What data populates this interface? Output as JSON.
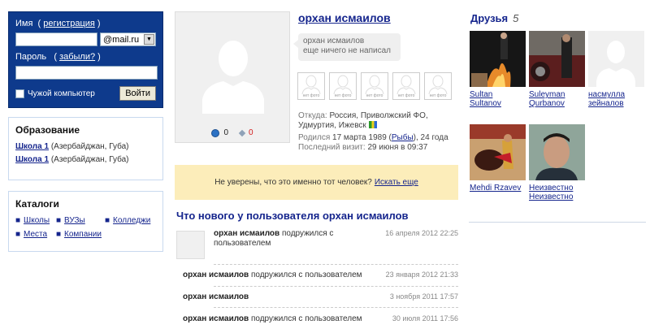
{
  "login": {
    "name_label": "Имя",
    "register_link": "регистрация",
    "domain": "@mail.ru",
    "password_label": "Пароль",
    "forgot_link": "забыли?",
    "foreign_computer": "Чужой компьютер",
    "login_button": "Войти"
  },
  "education": {
    "title": "Образование",
    "items": [
      {
        "school": "Школа 1",
        "place": "(Азербайджан, Губа)"
      },
      {
        "school": "Школа 1",
        "place": "(Азербайджан, Губа)"
      }
    ]
  },
  "catalogs": {
    "title": "Каталоги",
    "links": [
      "Школы",
      "ВУЗы",
      "Колледжи",
      "Места",
      "Компании"
    ]
  },
  "profile": {
    "name": "орхан исмаилов",
    "status_name": "орхан исмаилов",
    "status_text": "еще ничего не написал",
    "stat_a": "0",
    "stat_b": "0",
    "no_photo": "нет фото",
    "from_label": "Откуда:",
    "from_value": "Россия, Приволжский ФО, Удмуртия, Ижевск",
    "born_label": "Родился",
    "born_date": "17 марта 1989",
    "zodiac": "Рыбы",
    "age": ", 24 года",
    "visit_label": "Последний визит:",
    "visit_value": "29 июня в 09:37"
  },
  "banner": {
    "text": "Не уверены, что это именно тот человек?",
    "link": "Искать еще"
  },
  "feed": {
    "title": "Что нового у пользователя орхан исмаилов",
    "items": [
      {
        "user": "орхан исмаилов",
        "action": " подружился с пользователем",
        "date": "16 апреля 2012 22:25"
      },
      {
        "user": "орхан исмаилов",
        "action": " подружился с пользователем",
        "date": "23 января 2012 21:33"
      },
      {
        "user": "орхан исмаилов",
        "action": "",
        "date": "3 ноября 2011 17:57"
      },
      {
        "user": "орхан исмаилов",
        "action": " подружился с пользователем",
        "date": "30 июля 2011 17:56"
      }
    ]
  },
  "friends": {
    "title": "Друзья",
    "count": "5",
    "list": [
      {
        "name": "Sultan Sultanov"
      },
      {
        "name": "Suleyman Qurbanov"
      },
      {
        "name": "насмулла зейналов"
      },
      {
        "name": "Mehdi Rzavev"
      },
      {
        "name": "Неизвестно Неизвестно"
      }
    ]
  }
}
